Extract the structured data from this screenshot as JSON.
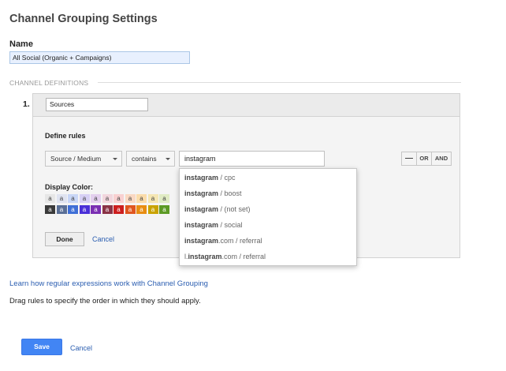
{
  "page": {
    "title": "Channel Grouping Settings",
    "name_label": "Name",
    "name_value": "All Social (Organic + Campaigns)",
    "section_heading": "CHANNEL DEFINITIONS"
  },
  "channel": {
    "number": "1.",
    "name_value": "Sources",
    "define_rules_label": "Define rules",
    "dimension": "Source / Medium",
    "operator": "contains",
    "match_value": "instagram",
    "logic": {
      "remove": "—",
      "or": "OR",
      "and": "AND"
    },
    "display_color_label": "Display Color:",
    "swatch_letter": "a",
    "swatches_top": [
      {
        "bg": "#e6e6e6",
        "fg": "#444444"
      },
      {
        "bg": "#dfe3f0",
        "fg": "#444444"
      },
      {
        "bg": "#c8d6f6",
        "fg": "#444444"
      },
      {
        "bg": "#d7d0f5",
        "fg": "#444444"
      },
      {
        "bg": "#e3cfee",
        "fg": "#444444"
      },
      {
        "bg": "#f2d6dd",
        "fg": "#444444"
      },
      {
        "bg": "#f9d0d0",
        "fg": "#444444"
      },
      {
        "bg": "#fad8c2",
        "fg": "#444444"
      },
      {
        "bg": "#fbdcaa",
        "fg": "#444444"
      },
      {
        "bg": "#f5e6b2",
        "fg": "#444444"
      },
      {
        "bg": "#e0ebc3",
        "fg": "#444444"
      }
    ],
    "swatches_bottom": [
      {
        "bg": "#3a3a3a",
        "fg": "#ffffff"
      },
      {
        "bg": "#5a6f96",
        "fg": "#ffffff"
      },
      {
        "bg": "#3f6fd6",
        "fg": "#ffffff"
      },
      {
        "bg": "#4a2fd8",
        "fg": "#ffffff"
      },
      {
        "bg": "#7b2fb3",
        "fg": "#ffffff"
      },
      {
        "bg": "#8a3346",
        "fg": "#ffffff"
      },
      {
        "bg": "#cc1e1e",
        "fg": "#ffffff"
      },
      {
        "bg": "#e0561f",
        "fg": "#ffffff"
      },
      {
        "bg": "#e88d12",
        "fg": "#ffffff"
      },
      {
        "bg": "#c9a300",
        "fg": "#ffffff"
      },
      {
        "bg": "#5c9a24",
        "fg": "#ffffff"
      }
    ],
    "done_label": "Done",
    "cancel_label": "Cancel"
  },
  "autocomplete": {
    "items": [
      {
        "match": "instagram",
        "rest": " / cpc",
        "selected": true
      },
      {
        "match": "instagram",
        "rest": " / boost",
        "selected": false
      },
      {
        "match": "instagram",
        "rest": " / (not set)",
        "selected": false
      },
      {
        "match": "instagram",
        "rest": " / social",
        "selected": false
      },
      {
        "match": "instagram",
        "rest": ".com / referral",
        "selected": false
      },
      {
        "prefix": "l.",
        "match": "instagram",
        "rest": ".com / referral",
        "selected": false
      }
    ]
  },
  "footer": {
    "learn_link": "Learn how regular expressions work with Channel Grouping",
    "drag_hint": "Drag rules to specify the order in which they should apply.",
    "save_label": "Save",
    "cancel_label": "Cancel"
  },
  "colors": {
    "accent_blue": "#4285f4",
    "link": "#2a5db0",
    "selected_item": "#7a9cd9"
  }
}
